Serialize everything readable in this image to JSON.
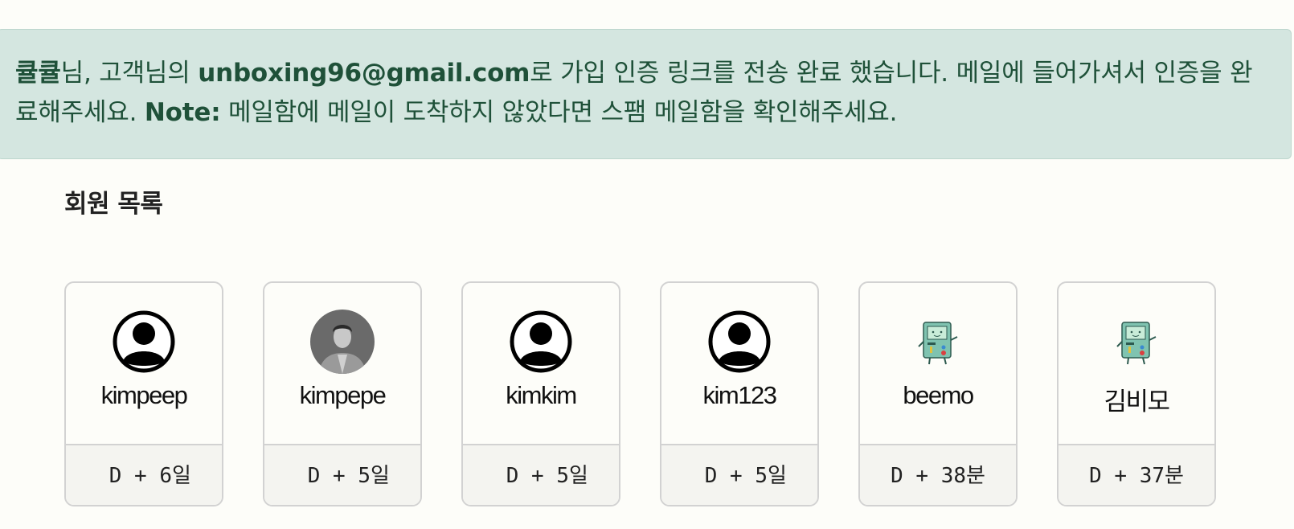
{
  "alert": {
    "name": "큘큘",
    "text1": "님, 고객님의 ",
    "email": "unboxing96@gmail.com",
    "text2": "로 가입 인증 링크를 전송 완료 했습니다. 메일에 들어가셔서 인증을 완료해주세요. ",
    "note_label": "Note:",
    "note_text": " 메일함에 메일이 도착하지 않았다면 스팸 메일함을 확인해주세요."
  },
  "section_title": "회원 목록",
  "members": [
    {
      "username": "kimpeep",
      "joined": " D + 6일",
      "avatar": "default-user-icon"
    },
    {
      "username": "kimpepe",
      "joined": " D + 5일",
      "avatar": "photo"
    },
    {
      "username": "kimkim",
      "joined": " D + 5일",
      "avatar": "default-user-icon"
    },
    {
      "username": "kim123",
      "joined": " D + 5일",
      "avatar": "default-user-icon"
    },
    {
      "username": "beemo",
      "joined": "D + 38분",
      "avatar": "bmo"
    },
    {
      "username": "김비모",
      "joined": "D + 37분",
      "avatar": "bmo"
    }
  ]
}
